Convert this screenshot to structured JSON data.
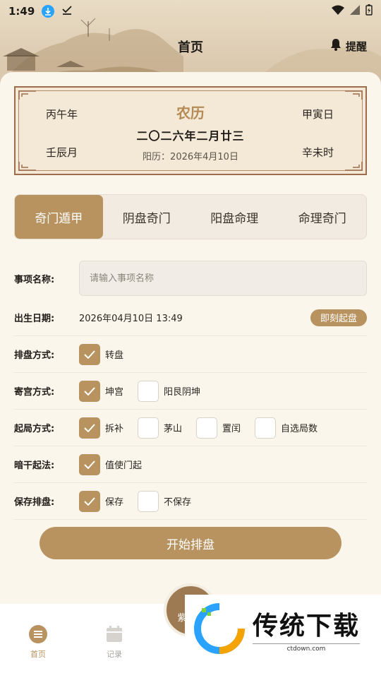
{
  "status": {
    "time": "1:49"
  },
  "header": {
    "title": "首页",
    "remind_label": "提醒"
  },
  "almanac": {
    "year_gz": "丙午年",
    "day_gz": "甲寅日",
    "month_gz": "壬辰月",
    "hour_gz": "辛未时",
    "title": "农历",
    "lunar_date": "二〇二六年二月廿三",
    "solar_date": "阳历：2026年4月10日"
  },
  "tabs": [
    {
      "label": "奇门遁甲",
      "active": true
    },
    {
      "label": "阴盘奇门",
      "active": false
    },
    {
      "label": "阳盘命理",
      "active": false
    },
    {
      "label": "命理奇门",
      "active": false
    }
  ],
  "form": {
    "name_label": "事项名称:",
    "name_placeholder": "请输入事项名称",
    "birth_label": "出生日期:",
    "birth_value": "2026年04月10日 13:49",
    "now_button": "即刻起盘",
    "options": [
      {
        "label": "排盘方式:",
        "choices": [
          {
            "text": "转盘",
            "checked": true
          }
        ]
      },
      {
        "label": "寄宫方式:",
        "choices": [
          {
            "text": "坤宫",
            "checked": true
          },
          {
            "text": "阳艮阴坤",
            "checked": false
          }
        ]
      },
      {
        "label": "起局方式:",
        "choices": [
          {
            "text": "拆补",
            "checked": true
          },
          {
            "text": "茅山",
            "checked": false
          },
          {
            "text": "置闰",
            "checked": false
          },
          {
            "text": "自选局数",
            "checked": false
          }
        ]
      },
      {
        "label": "暗干起法:",
        "choices": [
          {
            "text": "值使门起",
            "checked": true
          }
        ]
      },
      {
        "label": "保存排盘:",
        "choices": [
          {
            "text": "保存",
            "checked": true
          },
          {
            "text": "不保存",
            "checked": false
          }
        ]
      }
    ]
  },
  "start_button": "开始排盘",
  "nav": {
    "items": [
      {
        "label": "首页",
        "active": true
      },
      {
        "label": "记录",
        "active": false
      }
    ],
    "fab_label": "紫"
  },
  "watermark": {
    "brand": "传统下载",
    "url": "ctdown.com"
  },
  "colors": {
    "accent": "#b8935f",
    "title_gold": "#b48a55",
    "frame": "#9b6d4d"
  }
}
